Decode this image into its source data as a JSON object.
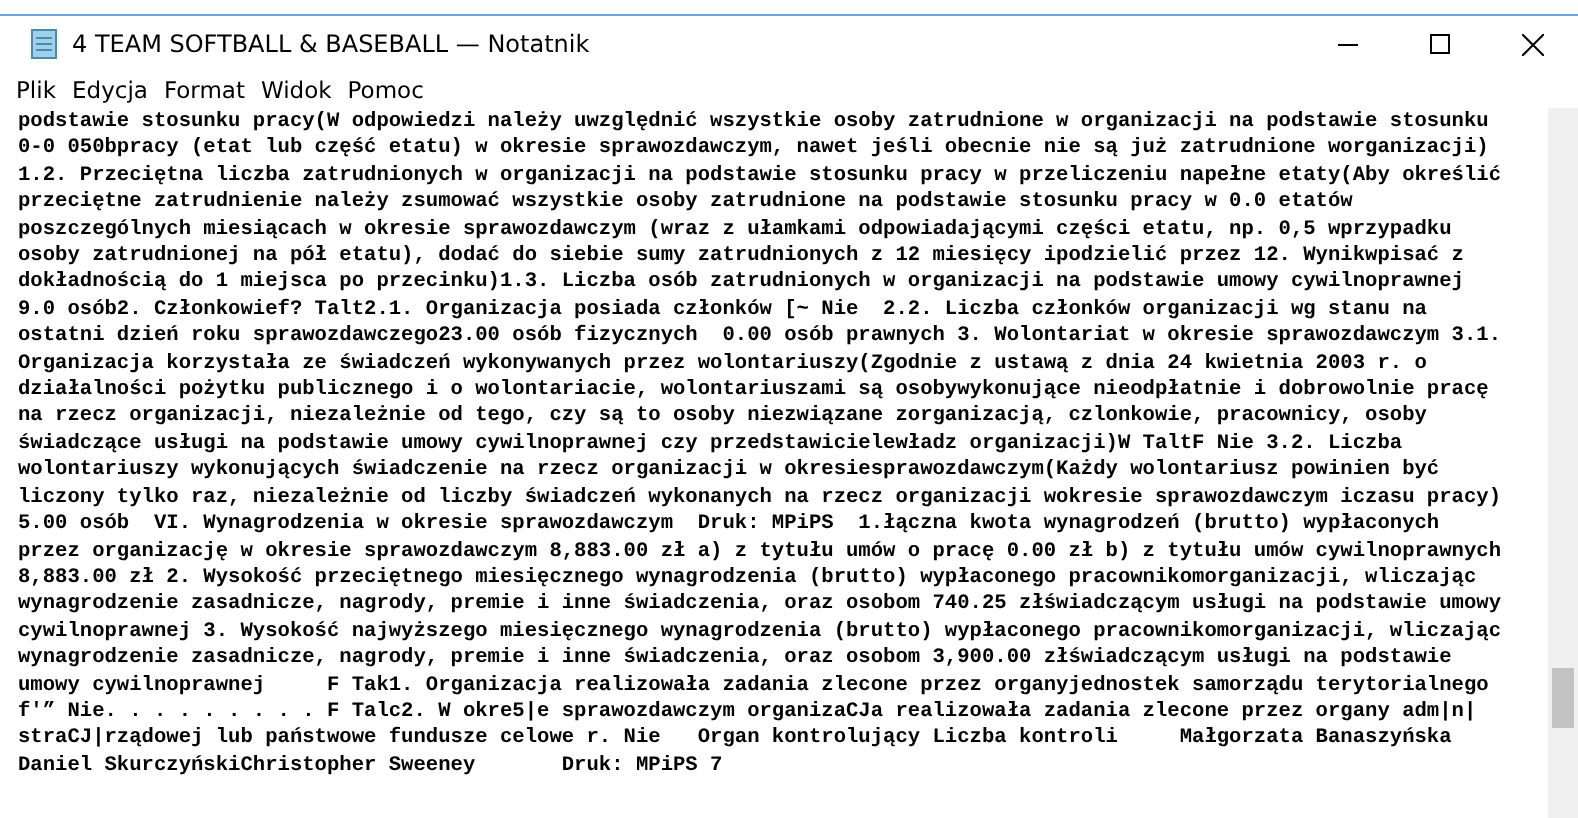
{
  "window": {
    "title": "4 TEAM SOFTBALL & BASEBALL — Notatnik"
  },
  "menu": [
    "Plik",
    "Edycja",
    "Format",
    "Widok",
    "Pomoc"
  ],
  "lines": [
    "podstawie stosunku pracy(W odpowiedzi należy uwzględnić wszystkie osoby zatrudnione w organizacji na podstawie stosunku",
    "0-0 050bpracy (etat lub część etatu) w okresie sprawozdawczym, nawet jeśli obecnie nie są już zatrudnione worganizacji)",
    "1.2. Przeciętna liczba zatrudnionych w organizacji na podstawie stosunku pracy w przeliczeniu napełne etaty(Aby określić",
    "przeciętne zatrudnienie należy zsumować wszystkie osoby zatrudnione na podstawie stosunku pracy w 0.0 etatów",
    "poszczególnych miesiącach w okresie sprawozdawczym (wraz z ułamkami odpowiadającymi części etatu, np. 0,5 wprzypadku",
    "osoby zatrudnionej na pół etatu), dodać do siebie sumy zatrudnionych z 12 miesięcy ipodzielić przez 12. Wynikwpisać z",
    "dokładnością do 1 miejsca po przecinku)1.3. Liczba osób zatrudnionych w organizacji na podstawie umowy cywilnoprawnej",
    "9.0 osób2. Członkowief? Talt2.1. Organizacja posiada członków [~ Nie  2.2. Liczba członków organizacji wg stanu na",
    "ostatni dzień roku sprawozdawczego23.00 osób fizycznych  0.00 osób prawnych 3. Wolontariat w okresie sprawozdawczym 3.1.",
    "Organizacja korzystała ze świadczeń wykonywanych przez wolontariuszy(Zgodnie z ustawą z dnia 24 kwietnia 2003 r. o",
    "działalności pożytku publicznego i o wolontariacie, wolontariuszami są osobywykonujące nieodpłatnie i dobrowolnie pracę",
    "na rzecz organizacji, niezależnie od tego, czy są to osoby niezwiązane zorganizacją, czlonkowie, pracownicy, osoby",
    "świadczące usługi na podstawie umowy cywilnoprawnej czy przedstawicielewładz organizacji)W TaltF Nie 3.2. Liczba",
    "wolontariuszy wykonujących świadczenie na rzecz organizacji w okresiesprawozdawczym(Każdy wolontariusz powinien być",
    "liczony tylko raz, niezależnie od liczby świadczeń wykonanych na rzecz organizacji wokresie sprawozdawczym iczasu pracy)",
    "5.00 osób  VI. Wynagrodzenia w okresie sprawozdawczym  Druk: MPiPS  1.łączna kwota wynagrodzeń (brutto) wypłaconych",
    "przez organizację w okresie sprawozdawczym 8,883.00 zł a) z tytułu umów o pracę 0.00 zł b) z tytułu umów cywilnoprawnych",
    "8,883.00 zł 2. Wysokość przeciętnego miesięcznego wynagrodzenia (brutto) wypłaconego pracownikomorganizacji, wliczając",
    "wynagrodzenie zasadnicze, nagrody, premie i inne świadczenia, oraz osobom 740.25 złświadczącym usługi na podstawie umowy",
    "cywilnoprawnej 3. Wysokość najwyższego miesięcznego wynagrodzenia (brutto) wypłaconego pracownikomorganizacji, wliczając",
    "wynagrodzenie zasadnicze, nagrody, premie i inne świadczenia, oraz osobom 3,900.00 złświadczącym usługi na podstawie",
    "umowy cywilnoprawnej     F Tak1. Organizacja realizowała zadania zlecone przez organyjednostek samorządu terytorialnego",
    "f'” Nie. . . . . . . . . F Talc2. W okre5|e sprawozdawczym organizaCJa realizowała zadania zlecone przez organy adm|n|",
    "straCJ|rządowej lub państwowe fundusze celowe r. Nie   Organ kontrolujący Liczba kontroli     Małgorzata Banaszyńska",
    "Daniel SkurczyńskiChristopher Sweeney       Druk: MPiPS 7"
  ]
}
